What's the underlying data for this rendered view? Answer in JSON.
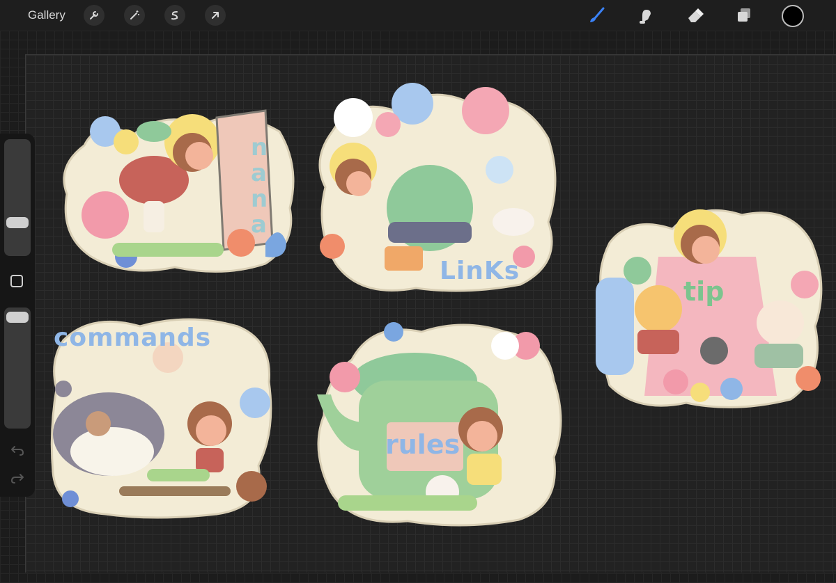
{
  "toolbar": {
    "gallery_label": "Gallery",
    "left_tools": [
      "wrench-icon",
      "magic-wand-icon",
      "selection-s-icon",
      "transform-arrow-icon"
    ],
    "right_tools": [
      "brush-icon",
      "smudge-icon",
      "eraser-icon",
      "layers-icon"
    ],
    "active_tool": "brush-icon",
    "accent_color": "#3b82f6",
    "current_color": "#000000"
  },
  "sidebar": {
    "brush_size_level": 0.65,
    "opacity_level": 0.05
  },
  "stickers": {
    "nana": {
      "title": "nana"
    },
    "links": {
      "title": "LinKs"
    },
    "tip": {
      "title": "tip"
    },
    "commands": {
      "title": "commands"
    },
    "rules": {
      "title": "rules"
    }
  },
  "palette": {
    "sticker_bg": "#f3ecd6",
    "green": "#8fc99a",
    "pink": "#f4a7b4",
    "blue": "#a8c8ee",
    "yellow": "#f6de7a",
    "brown": "#a86a4a",
    "text_blue": "#7aa6e0",
    "text_green": "#7cc48e",
    "text_pink": "#f29aaa"
  }
}
